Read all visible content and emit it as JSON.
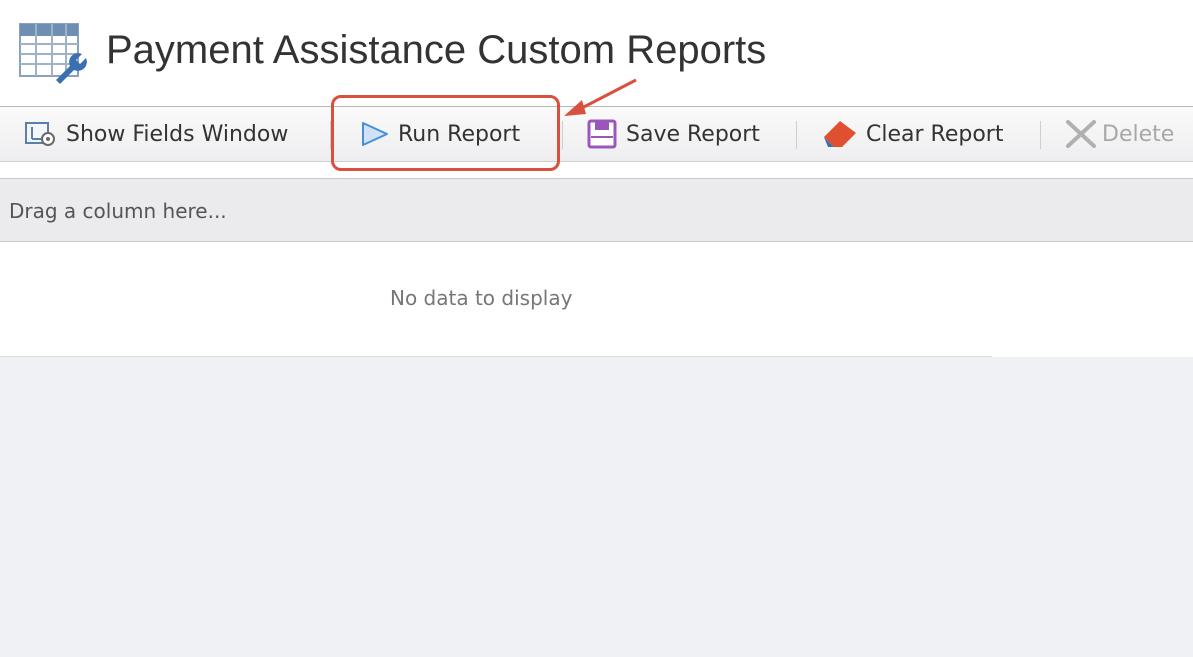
{
  "header": {
    "title": "Payment Assistance Custom Reports",
    "icon": "report-settings-icon"
  },
  "toolbar": {
    "show_fields_label": "Show Fields Window",
    "run_report_label": "Run Report",
    "save_report_label": "Save Report",
    "clear_report_label": "Clear Report",
    "delete_label": "Delete"
  },
  "grid": {
    "group_panel_text": "Drag a column here...",
    "empty_text": "No data to display"
  },
  "colors": {
    "annotation": "#d9503f",
    "run_icon": "#4a8fd6",
    "save_icon": "#9a56b8",
    "clear_icon": "#e05030"
  },
  "icons": {
    "show_fields": "fields-window-icon",
    "run_report": "play-icon",
    "save_report": "floppy-disk-icon",
    "clear_report": "eraser-icon",
    "delete": "close-icon"
  }
}
